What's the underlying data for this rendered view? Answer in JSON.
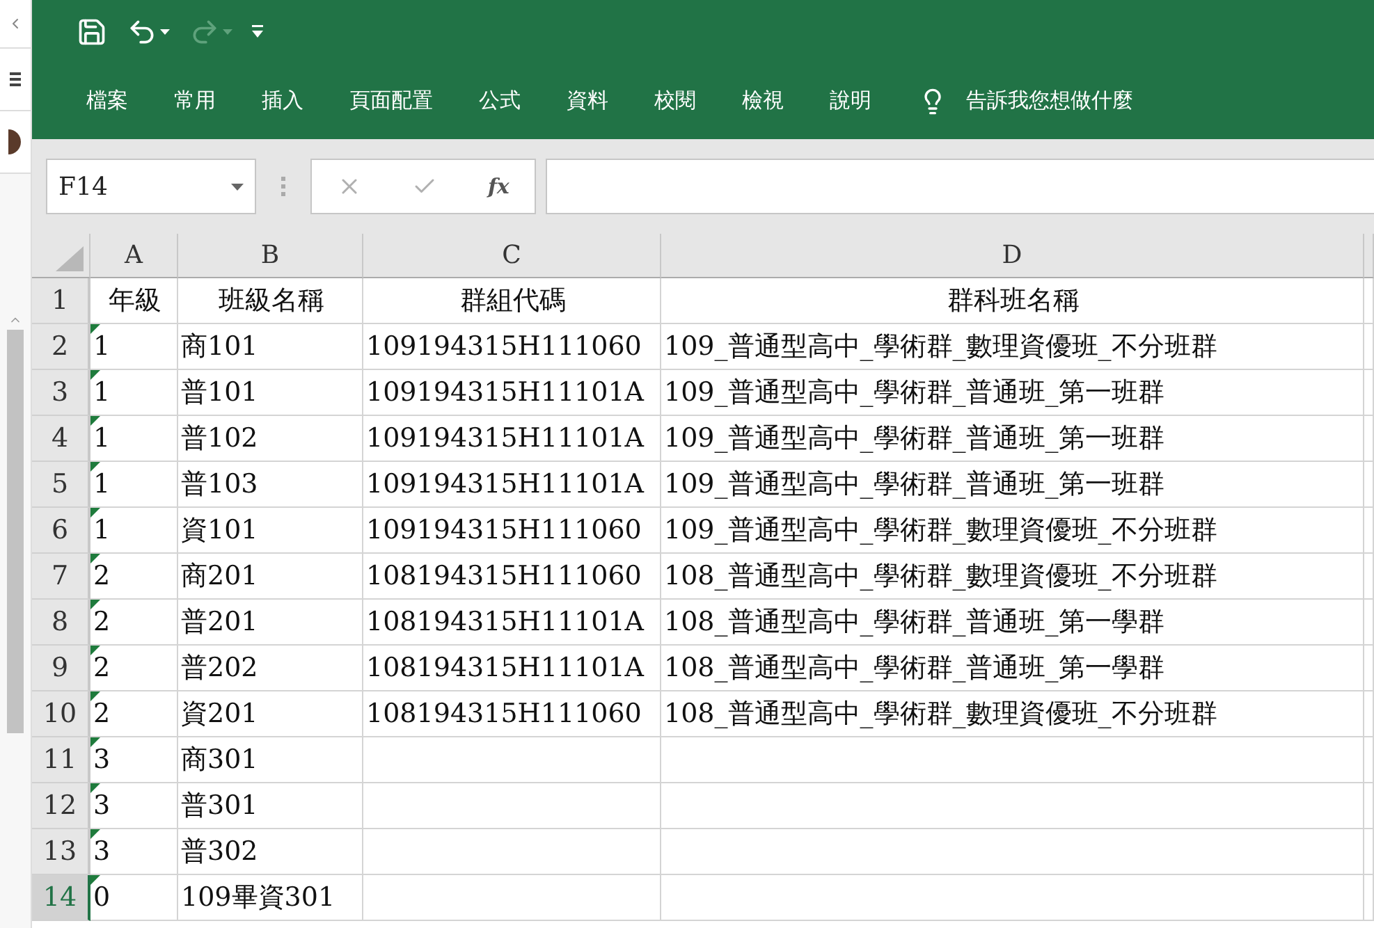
{
  "ribbon_tabs": [
    {
      "label": "檔案",
      "selected": false
    },
    {
      "label": "常用",
      "selected": false
    },
    {
      "label": "插入",
      "selected": false
    },
    {
      "label": "頁面配置",
      "selected": false
    },
    {
      "label": "公式",
      "selected": false
    },
    {
      "label": "資料",
      "selected": false
    },
    {
      "label": "校閱",
      "selected": false
    },
    {
      "label": "檢視",
      "selected": false
    },
    {
      "label": "說明",
      "selected": false
    }
  ],
  "tell_me": "告訴我您想做什麼",
  "name_box": {
    "value": "F14"
  },
  "function_label": "fx",
  "columns": [
    "A",
    "B",
    "C",
    "D"
  ],
  "rows": [
    {
      "number": "1",
      "selected": false,
      "kind": "header",
      "cells": [
        {
          "text": "年級"
        },
        {
          "text": "班級名稱"
        },
        {
          "text": "群組代碼"
        },
        {
          "text": "群科班名稱"
        }
      ]
    },
    {
      "number": "2",
      "selected": false,
      "kind": "data",
      "marker": true,
      "cells": [
        {
          "text": "1"
        },
        {
          "text": "商101"
        },
        {
          "text": "109194315H111060"
        },
        {
          "text": "109_普通型高中_學術群_數理資優班_不分班群"
        }
      ]
    },
    {
      "number": "3",
      "selected": false,
      "kind": "data",
      "marker": true,
      "cells": [
        {
          "text": "1"
        },
        {
          "text": "普101"
        },
        {
          "text": "109194315H11101A"
        },
        {
          "text": "109_普通型高中_學術群_普通班_第一班群"
        }
      ]
    },
    {
      "number": "4",
      "selected": false,
      "kind": "data",
      "marker": true,
      "cells": [
        {
          "text": "1"
        },
        {
          "text": "普102"
        },
        {
          "text": "109194315H11101A"
        },
        {
          "text": "109_普通型高中_學術群_普通班_第一班群"
        }
      ]
    },
    {
      "number": "5",
      "selected": false,
      "kind": "data",
      "marker": true,
      "cells": [
        {
          "text": "1"
        },
        {
          "text": "普103"
        },
        {
          "text": "109194315H11101A"
        },
        {
          "text": "109_普通型高中_學術群_普通班_第一班群"
        }
      ]
    },
    {
      "number": "6",
      "selected": false,
      "kind": "data",
      "marker": true,
      "cells": [
        {
          "text": "1"
        },
        {
          "text": "資101"
        },
        {
          "text": "109194315H111060"
        },
        {
          "text": "109_普通型高中_學術群_數理資優班_不分班群"
        }
      ]
    },
    {
      "number": "7",
      "selected": false,
      "kind": "data",
      "marker": true,
      "cells": [
        {
          "text": "2"
        },
        {
          "text": "商201"
        },
        {
          "text": "108194315H111060"
        },
        {
          "text": "108_普通型高中_學術群_數理資優班_不分班群"
        }
      ]
    },
    {
      "number": "8",
      "selected": false,
      "kind": "data",
      "marker": true,
      "cells": [
        {
          "text": "2"
        },
        {
          "text": "普201"
        },
        {
          "text": "108194315H11101A"
        },
        {
          "text": "108_普通型高中_學術群_普通班_第一學群"
        }
      ]
    },
    {
      "number": "9",
      "selected": false,
      "kind": "data",
      "marker": true,
      "cells": [
        {
          "text": "2"
        },
        {
          "text": "普202"
        },
        {
          "text": "108194315H11101A"
        },
        {
          "text": "108_普通型高中_學術群_普通班_第一學群"
        }
      ]
    },
    {
      "number": "10",
      "selected": false,
      "kind": "data",
      "marker": true,
      "cells": [
        {
          "text": "2"
        },
        {
          "text": "資201"
        },
        {
          "text": "108194315H111060"
        },
        {
          "text": "108_普通型高中_學術群_數理資優班_不分班群"
        }
      ]
    },
    {
      "number": "11",
      "selected": false,
      "kind": "data",
      "marker": true,
      "cells": [
        {
          "text": "3"
        },
        {
          "text": "商301"
        }
      ]
    },
    {
      "number": "12",
      "selected": false,
      "kind": "data",
      "marker": true,
      "cells": [
        {
          "text": "3"
        },
        {
          "text": "普301"
        }
      ]
    },
    {
      "number": "13",
      "selected": false,
      "kind": "data",
      "marker": true,
      "cells": [
        {
          "text": "3"
        },
        {
          "text": "普302"
        }
      ]
    },
    {
      "number": "14",
      "selected": true,
      "kind": "data",
      "marker": true,
      "cells": [
        {
          "text": "0"
        },
        {
          "text": "109畢資301"
        }
      ]
    }
  ]
}
